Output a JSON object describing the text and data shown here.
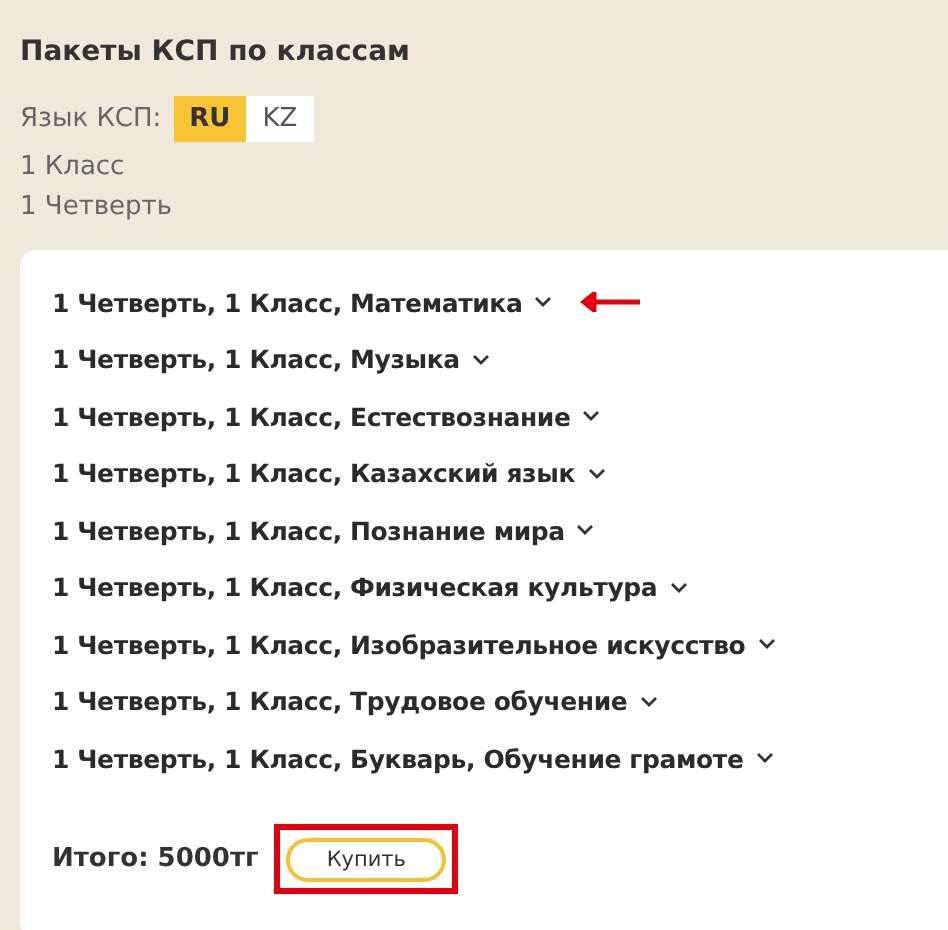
{
  "title": "Пакеты КСП по классам",
  "language": {
    "label": "Язык КСП:",
    "options": [
      {
        "label": "RU",
        "selected": true
      },
      {
        "label": "KZ",
        "selected": false
      }
    ]
  },
  "info": [
    "1 Класс",
    "1 Четверть"
  ],
  "packages": [
    {
      "label": "1 Четверть, 1 Класс, Математика",
      "expanded": false,
      "pointed": true
    },
    {
      "label": "1 Четверть, 1 Класс, Музыка",
      "expanded": false,
      "pointed": false
    },
    {
      "label": "1 Четверть, 1 Класс, Естествознание",
      "expanded": false,
      "pointed": false
    },
    {
      "label": "1 Четверть, 1 Класс, Казахский язык",
      "expanded": false,
      "pointed": false
    },
    {
      "label": "1 Четверть, 1 Класс, Познание мира",
      "expanded": false,
      "pointed": false
    },
    {
      "label": "1 Четверть, 1 Класс, Физическая культура",
      "expanded": false,
      "pointed": false
    },
    {
      "label": "1 Четверть, 1 Класс, Изобразительное искусство",
      "expanded": false,
      "pointed": false
    },
    {
      "label": "1 Четверть, 1 Класс, Трудовое обучение",
      "expanded": false,
      "pointed": false
    },
    {
      "label": "1 Четверть, 1 Класс, Букварь, Обучение грамоте",
      "expanded": false,
      "pointed": false
    }
  ],
  "total": "Итого: 5000тг",
  "buy_button": {
    "label": "Купить",
    "highlighted": true
  }
}
